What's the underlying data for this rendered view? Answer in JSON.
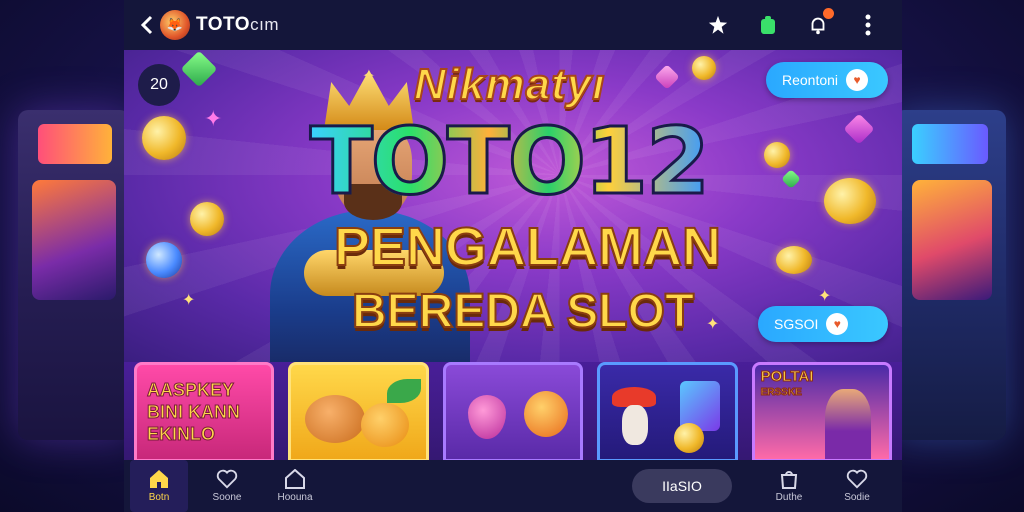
{
  "app": {
    "brand_main": "TOTO",
    "brand_suffix": "cım"
  },
  "hero": {
    "counter": "20",
    "headline_small": "Nikmatyı",
    "headline_big": "TOTO12",
    "headline_mid": "PENGALAMAN",
    "headline_sub": "BEREDA SLOT",
    "button_top_label": "Reontoni",
    "button_mid_label": "SGSOI"
  },
  "tiles": [
    {
      "title_lines": [
        "AASPKEY",
        "BINI KANN",
        "EKINLO"
      ]
    },
    {
      "title_lines": []
    },
    {
      "title_lines": []
    },
    {
      "title_lines": []
    },
    {
      "title_lines": [
        "POLTAI",
        "ERSSKE"
      ]
    }
  ],
  "bottom_nav": {
    "items": [
      {
        "label": "Botn",
        "icon": "home-icon",
        "active": true
      },
      {
        "label": "Soone",
        "icon": "heart-icon",
        "active": false
      },
      {
        "label": "Hoouna",
        "icon": "house-outline-icon",
        "active": false
      }
    ],
    "pill_label": "IIaSIO",
    "right_items": [
      {
        "label": "Duthe",
        "icon": "bag-icon"
      },
      {
        "label": "Sodie",
        "icon": "heart-icon"
      }
    ]
  },
  "colors": {
    "topbar_bg": "#14163a",
    "accent_gold": "#ffd84a",
    "button_blue": "#2aa8ff",
    "notification": "#ff6a2a"
  }
}
